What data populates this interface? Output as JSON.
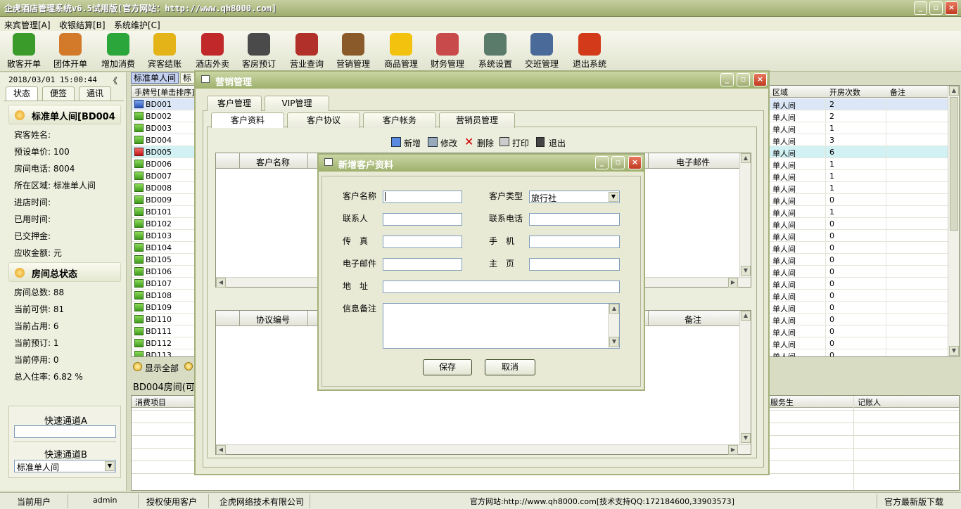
{
  "app": {
    "title": "企虎酒店管理系统v6.5试用版[官方网站：http://www.qh8000.com]"
  },
  "menu": [
    "来宾管理[A]",
    "收银结算[B]",
    "系统维护[C]"
  ],
  "toolbar": [
    {
      "label": "散客开单",
      "icon": "person-icon",
      "color": "#3a9a2a"
    },
    {
      "label": "团体开单",
      "icon": "group-icon",
      "color": "#d27a2a"
    },
    {
      "label": "增加消费",
      "icon": "add-icon",
      "color": "#2aa63a"
    },
    {
      "label": "宾客结账",
      "icon": "checkout-arrow-icon",
      "color": "#e3b318"
    },
    {
      "label": "酒店外卖",
      "icon": "takeout-icon",
      "color": "#c0282a"
    },
    {
      "label": "客房预订",
      "icon": "alarm-clock-icon",
      "color": "#4a4a4a"
    },
    {
      "label": "营业查询",
      "icon": "calendar-icon",
      "color": "#b2302a"
    },
    {
      "label": "营销管理",
      "icon": "people-icon",
      "color": "#8a5a2a"
    },
    {
      "label": "商品管理",
      "icon": "star-icon",
      "color": "#f2c20e"
    },
    {
      "label": "财务管理",
      "icon": "calculator-icon",
      "color": "#c84a4a"
    },
    {
      "label": "系统设置",
      "icon": "settings-icon",
      "color": "#5a7a6a"
    },
    {
      "label": "交班管理",
      "icon": "handshake-icon",
      "color": "#4a6a9a"
    },
    {
      "label": "退出系统",
      "icon": "power-icon",
      "color": "#d23a1a"
    }
  ],
  "left": {
    "datetime": "2018/03/01 15:00:44",
    "collapse": "《",
    "tabs": [
      "状态",
      "便签",
      "通讯"
    ],
    "room_title": "标准单人间[BD004",
    "room_fields": [
      "宾客姓名:",
      "预设单价: 100",
      "房间电话: 8004",
      "所在区域: 标准单人间",
      "进店时间:",
      "已用时间:",
      "已交押金:",
      "应收金额: 元"
    ],
    "status_title": "房间总状态",
    "status_fields": [
      "房间总数: 88",
      "当前可供: 81",
      "当前占用: 6",
      "当前预订: 1",
      "当前停用: 0",
      "总入住率: 6.82 %"
    ],
    "quick_a": "快速通道A",
    "quick_b": "快速通道B",
    "quick_b_value": "标准单人间"
  },
  "roomtabs": [
    "标准单人间",
    "标"
  ],
  "room_grid": {
    "col1": "手牌号[单击排序]",
    "rooms": [
      "BD001",
      "BD002",
      "BD003",
      "BD004",
      "BD005",
      "BD006",
      "BD007",
      "BD008",
      "BD009",
      "BD101",
      "BD102",
      "BD103",
      "BD104",
      "BD105",
      "BD106",
      "BD107",
      "BD108",
      "BD109",
      "BD110",
      "BD111",
      "BD112",
      "BD113"
    ],
    "cols_right": [
      "区域",
      "开房次数",
      "备注"
    ],
    "area": "单人间",
    "counts": [
      "2",
      "2",
      "1",
      "3",
      "6",
      "1",
      "1",
      "1",
      "0",
      "1",
      "0",
      "0",
      "0",
      "0",
      "0",
      "0",
      "0",
      "0",
      "0",
      "0",
      "0",
      "0"
    ]
  },
  "show_all": "显示全部",
  "room_info": "BD004房间(可",
  "consume_grid": {
    "col1": "消费项目",
    "col_waiter": "服务生",
    "col_booker": "记账人"
  },
  "yingxiao": {
    "title": "营销管理",
    "outer_tabs": [
      "客户管理",
      "VIP管理"
    ],
    "inner_tabs": [
      "客户资料",
      "客户协议",
      "客户帐务",
      "营销员管理"
    ],
    "actions": [
      "新增",
      "修改",
      "删除",
      "打印",
      "退出"
    ],
    "grid1_cols": [
      "客户名称",
      "电子邮件"
    ],
    "grid2_cols": [
      "协议编号",
      "备注"
    ]
  },
  "xinzeng": {
    "title": "新增客户资料",
    "labels": {
      "name": "客户名称",
      "type": "客户类型",
      "contact": "联系人",
      "phone": "联系电话",
      "fax": "传　真",
      "mobile": "手　机",
      "email": "电子邮件",
      "homepage": "主　页",
      "address": "地　址",
      "note": "信息备注"
    },
    "type_value": "旅行社",
    "save": "保存",
    "cancel": "取消"
  },
  "status": {
    "user_label": "当前用户",
    "user": "admin",
    "licensed_label": "授权使用客户",
    "licensed": "企虎网络技术有限公司",
    "site": "官方网站:http://www.qh8000.com[技术支持QQ:172184600,33903573]",
    "download": "官方最新版下载"
  }
}
